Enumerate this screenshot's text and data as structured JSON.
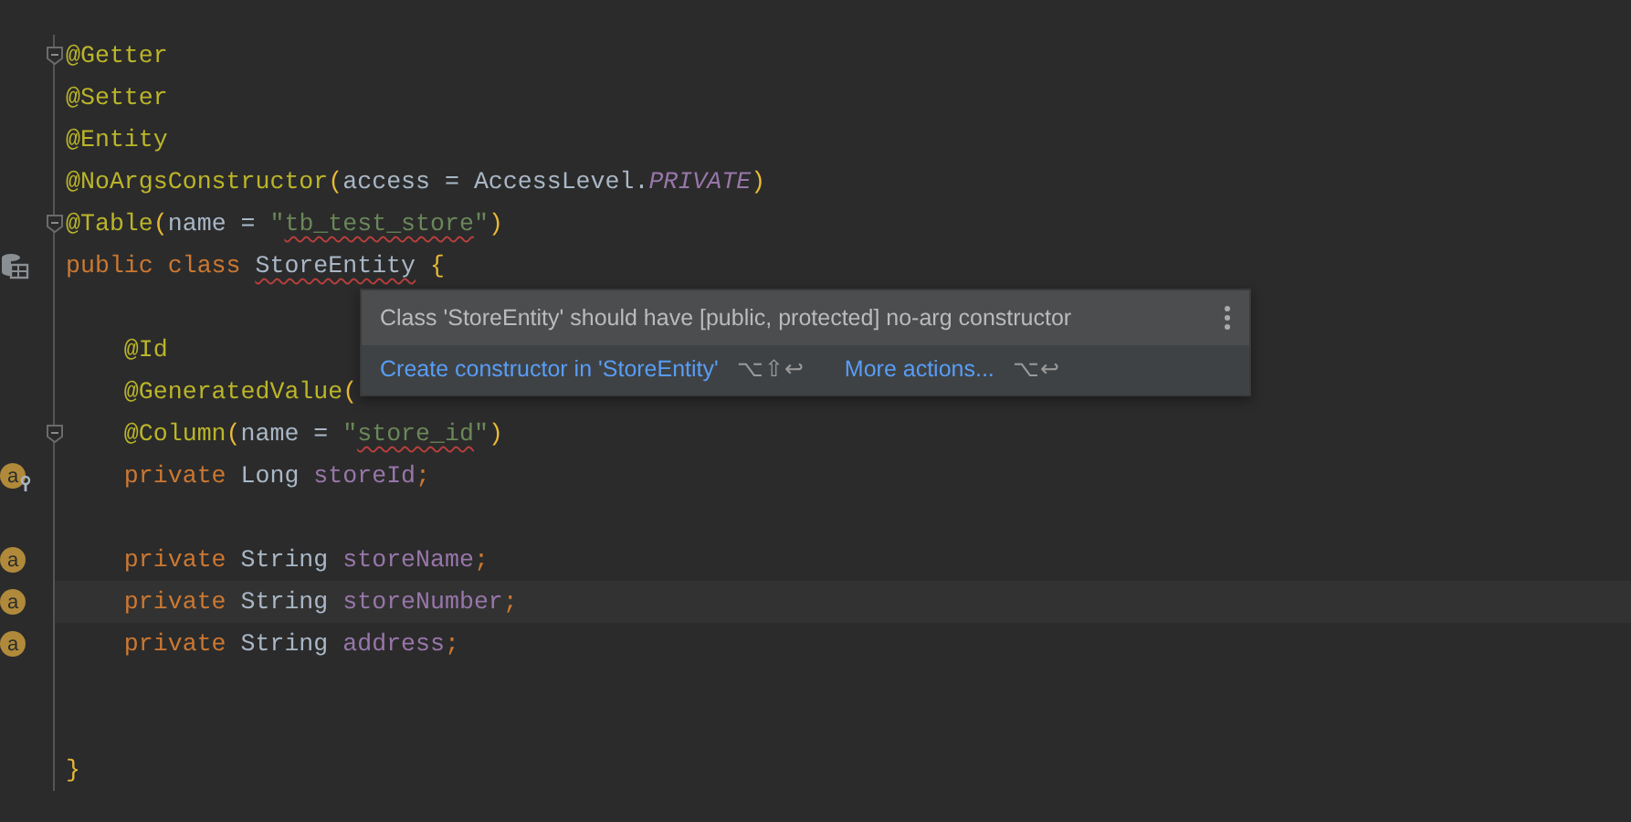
{
  "editor": {
    "lines": [
      {
        "kind": "code",
        "fold": true,
        "tokens": [
          {
            "kind": "annotation",
            "text": "@Getter"
          }
        ]
      },
      {
        "kind": "code",
        "tokens": [
          {
            "kind": "annotation",
            "text": "@Setter"
          }
        ]
      },
      {
        "kind": "code",
        "tokens": [
          {
            "kind": "annotation",
            "text": "@Entity"
          }
        ]
      },
      {
        "kind": "code",
        "tokens": [
          {
            "kind": "annotation",
            "text": "@NoArgsConstructor"
          },
          {
            "kind": "paren",
            "text": "("
          },
          {
            "kind": "plain",
            "text": "access = AccessLevel."
          },
          {
            "kind": "constant",
            "text": "PRIVATE"
          },
          {
            "kind": "paren",
            "text": ")"
          }
        ]
      },
      {
        "kind": "code",
        "fold": true,
        "tokens": [
          {
            "kind": "annotation",
            "text": "@Table"
          },
          {
            "kind": "paren",
            "text": "("
          },
          {
            "kind": "plain",
            "text": "name = "
          },
          {
            "kind": "string",
            "text": "\""
          },
          {
            "kind": "string",
            "text": "tb_test_store",
            "error": true
          },
          {
            "kind": "string",
            "text": "\""
          },
          {
            "kind": "paren",
            "text": ")"
          }
        ]
      },
      {
        "kind": "code",
        "gutter": {
          "kind": "table"
        },
        "tokens": [
          {
            "kind": "keyword",
            "text": "public class "
          },
          {
            "kind": "plain",
            "text": "StoreEntity",
            "error": true
          },
          {
            "kind": "paren",
            "text": " {"
          }
        ]
      },
      {
        "kind": "blank"
      },
      {
        "kind": "code",
        "tokens": [
          {
            "kind": "annotation",
            "text": "    @Id"
          }
        ]
      },
      {
        "kind": "code",
        "tokens": [
          {
            "kind": "annotation",
            "text": "    @GeneratedValue"
          },
          {
            "kind": "paren",
            "text": "("
          }
        ]
      },
      {
        "kind": "code",
        "fold": true,
        "tokens": [
          {
            "kind": "annotation",
            "text": "    @Column"
          },
          {
            "kind": "paren",
            "text": "("
          },
          {
            "kind": "plain",
            "text": "name = "
          },
          {
            "kind": "string",
            "text": "\""
          },
          {
            "kind": "string",
            "text": "store_id",
            "error": true
          },
          {
            "kind": "string",
            "text": "\""
          },
          {
            "kind": "paren",
            "text": ")"
          }
        ]
      },
      {
        "kind": "code",
        "gutter": {
          "kind": "field-key",
          "label": "a"
        },
        "tokens": [
          {
            "kind": "keyword",
            "text": "    private "
          },
          {
            "kind": "plain",
            "text": "Long "
          },
          {
            "kind": "field",
            "text": "storeId"
          },
          {
            "kind": "keyword",
            "text": ";"
          }
        ]
      },
      {
        "kind": "blank"
      },
      {
        "kind": "code",
        "gutter": {
          "kind": "field",
          "label": "a"
        },
        "tokens": [
          {
            "kind": "keyword",
            "text": "    private "
          },
          {
            "kind": "plain",
            "text": "String "
          },
          {
            "kind": "field",
            "text": "storeName"
          },
          {
            "kind": "keyword",
            "text": ";"
          }
        ]
      },
      {
        "kind": "code",
        "current": true,
        "gutter": {
          "kind": "field",
          "label": "a"
        },
        "tokens": [
          {
            "kind": "keyword",
            "text": "    private "
          },
          {
            "kind": "plain",
            "text": "String "
          },
          {
            "kind": "field",
            "text": "storeNumber"
          },
          {
            "kind": "keyword",
            "text": ";"
          }
        ]
      },
      {
        "kind": "code",
        "gutter": {
          "kind": "field",
          "label": "a"
        },
        "tokens": [
          {
            "kind": "keyword",
            "text": "    private "
          },
          {
            "kind": "plain",
            "text": "String "
          },
          {
            "kind": "field",
            "text": "address"
          },
          {
            "kind": "keyword",
            "text": ";"
          }
        ]
      },
      {
        "kind": "blank"
      },
      {
        "kind": "blank"
      },
      {
        "kind": "code",
        "tokens": [
          {
            "kind": "paren",
            "text": "}"
          }
        ]
      }
    ]
  },
  "popup": {
    "message": "Class 'StoreEntity' should have [public, protected] no-arg constructor",
    "actions": [
      {
        "label": "Create constructor in 'StoreEntity'",
        "shortcut": "⌥⇧↩"
      },
      {
        "label": "More actions...",
        "shortcut": "⌥↩"
      }
    ]
  }
}
